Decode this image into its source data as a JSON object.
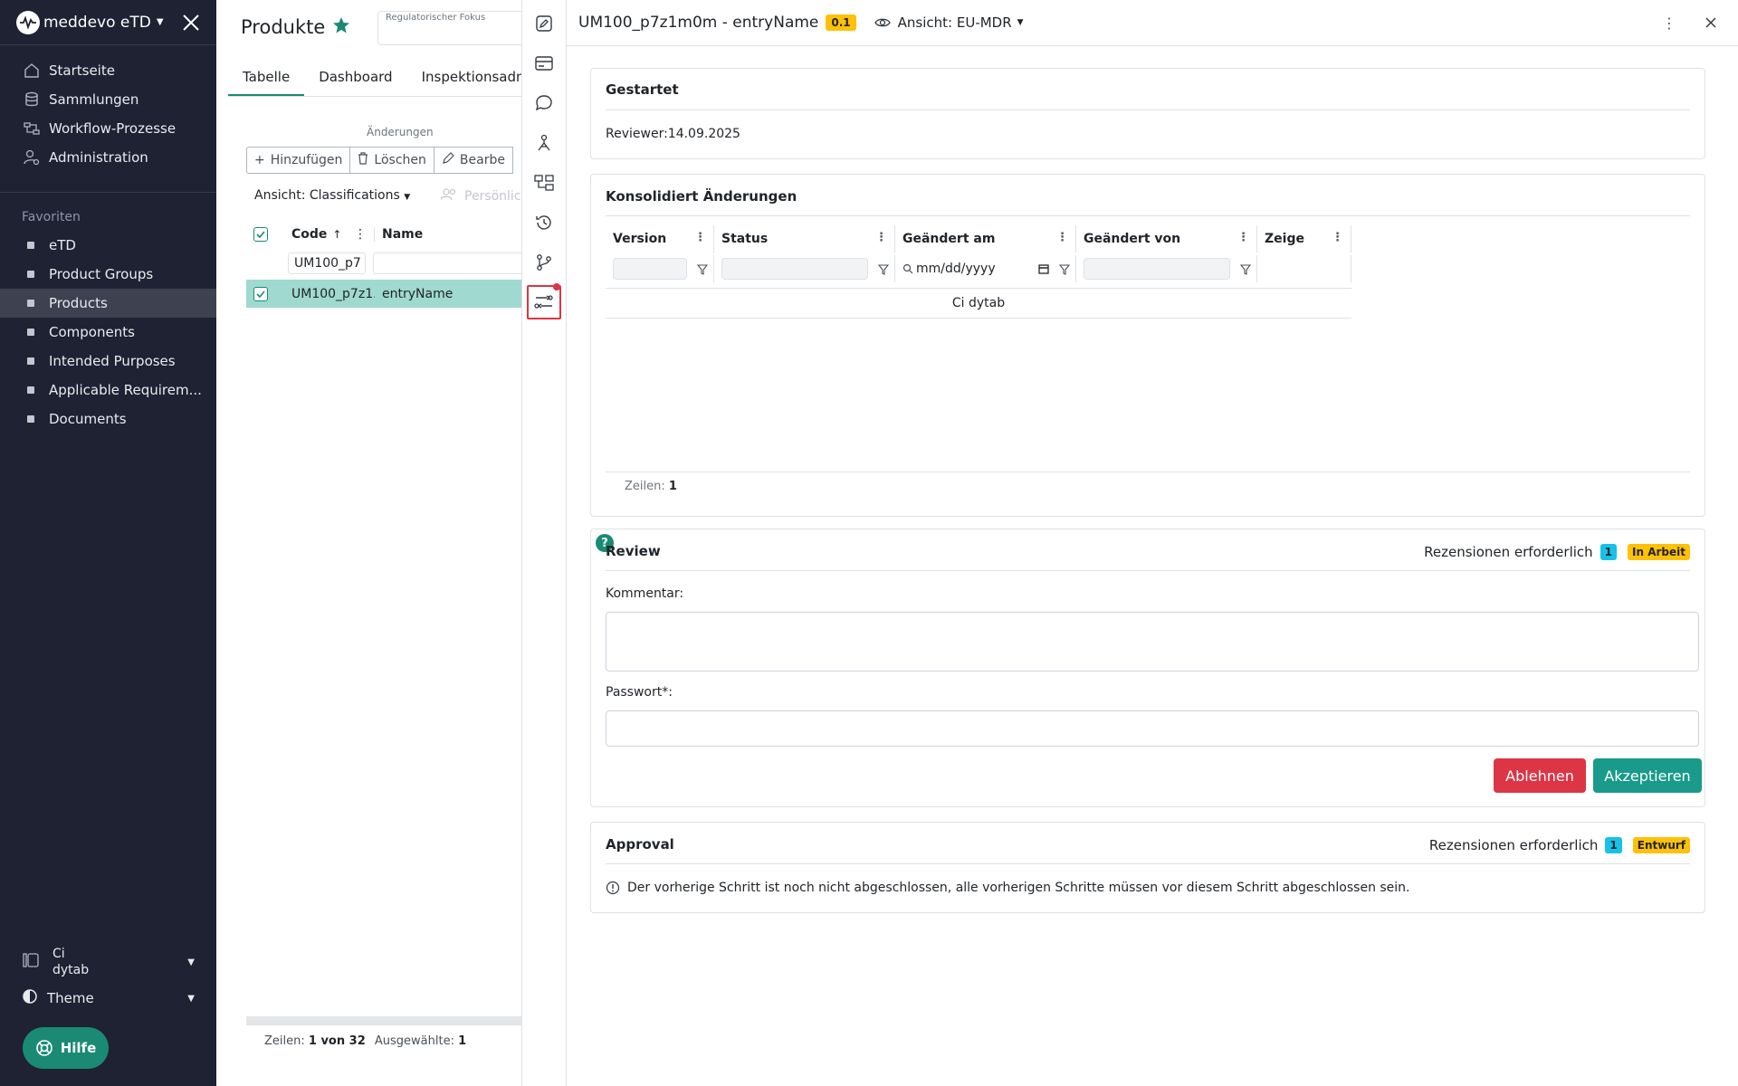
{
  "sidebar": {
    "app_name": "meddevo eTD",
    "nav": [
      {
        "label": "Startseite",
        "icon": "home-icon"
      },
      {
        "label": "Sammlungen",
        "icon": "database-icon"
      },
      {
        "label": "Workflow-Prozesse",
        "icon": "workflow-icon"
      },
      {
        "label": "Administration",
        "icon": "user-gear-icon"
      }
    ],
    "favorites_title": "Favoriten",
    "favorites": [
      "eTD",
      "Product Groups",
      "Products",
      "Components",
      "Intended Purposes",
      "Applicable Requirem...",
      "Documents"
    ],
    "active_favorite": "Products",
    "user": {
      "line1": "Ci",
      "line2": "dytab"
    },
    "theme_label": "Theme",
    "help_label": "Hilfe"
  },
  "main": {
    "title": "Produkte",
    "regulatory_label": "Regulatorischer Fokus",
    "tabs": [
      "Tabelle",
      "Dashboard",
      "Inspektionsadmin"
    ],
    "active_tab": "Tabelle",
    "changes_label": "Änderungen",
    "buttons": {
      "add": "Hinzufügen",
      "delete": "Löschen",
      "edit": "Bearbe"
    },
    "view_selector": "Ansicht: Classifications",
    "personal_label": "Persönlic",
    "columns": {
      "code": "Code",
      "name": "Name"
    },
    "filter_code": "UM100_p7",
    "row": {
      "code": "UM100_p7z1...",
      "name": "entryName"
    },
    "footer": {
      "rows_label": "Zeilen:",
      "rows_value": "1 von 32",
      "selected_label": "Ausgewählte:",
      "selected_value": "1"
    }
  },
  "detail": {
    "title": "UM100_p7z1m0m - entryName",
    "version": "0.1",
    "view": "Ansicht: EU-MDR",
    "started": {
      "title": "Gestartet",
      "reviewer": "Reviewer:14.09.2025"
    },
    "changes": {
      "title": "Konsolidiert Änderungen",
      "columns": [
        "Version",
        "Status",
        "Geändert am",
        "Geändert von",
        "Zeige"
      ],
      "date_placeholder": "mm/dd/yyyy",
      "row_user": "Ci dytab",
      "rows_label": "Zeilen:",
      "rows_value": "1"
    },
    "review": {
      "title": "Review",
      "required_label": "Rezensionen erforderlich",
      "required_count": "1",
      "status": "In Arbeit",
      "comment_label": "Kommentar:",
      "password_label": "Passwort*:",
      "reject": "Ablehnen",
      "accept": "Akzeptieren"
    },
    "approval": {
      "title": "Approval",
      "required_label": "Rezensionen erforderlich",
      "required_count": "1",
      "status": "Entwurf",
      "info": "Der vorherige Schritt ist noch nicht abgeschlossen, alle vorherigen Schritte müssen vor diesem Schritt abgeschlossen sein."
    }
  },
  "colors": {
    "accent": "#1a8a74",
    "sidebar_bg": "#1f2233",
    "danger": "#dc3545",
    "warning": "#ffc107",
    "info": "#17c1e8",
    "selected_row": "#9fd9d0"
  }
}
